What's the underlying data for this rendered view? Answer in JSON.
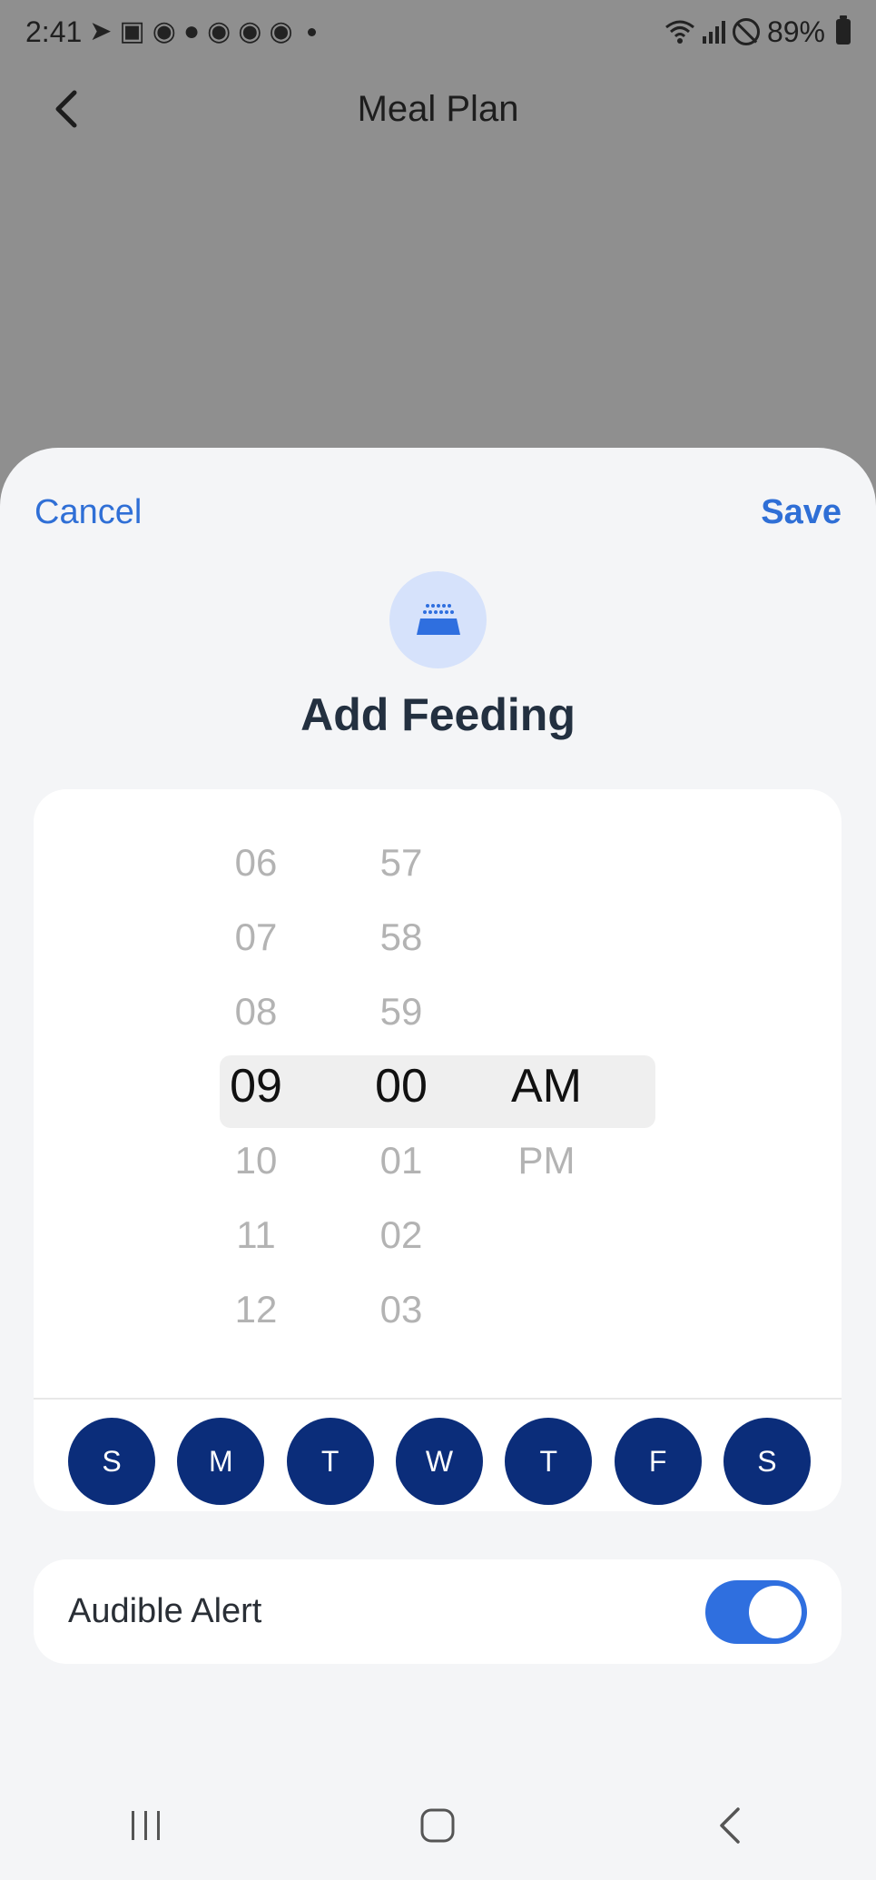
{
  "status_bar": {
    "time": "2:41",
    "battery_text": "89%"
  },
  "header": {
    "title": "Meal Plan"
  },
  "sheet": {
    "cancel_label": "Cancel",
    "save_label": "Save",
    "title": "Add Feeding",
    "icon": "feeder-bowl-icon",
    "accent_color": "#2f6fd6"
  },
  "picker": {
    "hours": [
      "06",
      "07",
      "08",
      "09",
      "10",
      "11",
      "12"
    ],
    "minutes": [
      "57",
      "58",
      "59",
      "00",
      "01",
      "02",
      "03"
    ],
    "ampm": [
      "",
      "",
      "",
      "AM",
      "PM",
      "",
      ""
    ],
    "selected_hour": "09",
    "selected_minute": "00",
    "selected_period": "AM"
  },
  "days": [
    "S",
    "M",
    "T",
    "W",
    "T",
    "F",
    "S"
  ],
  "day_color": "#0b2d7a",
  "alert": {
    "label": "Audible Alert",
    "enabled": true,
    "toggle_color": "#2f6fdf"
  }
}
